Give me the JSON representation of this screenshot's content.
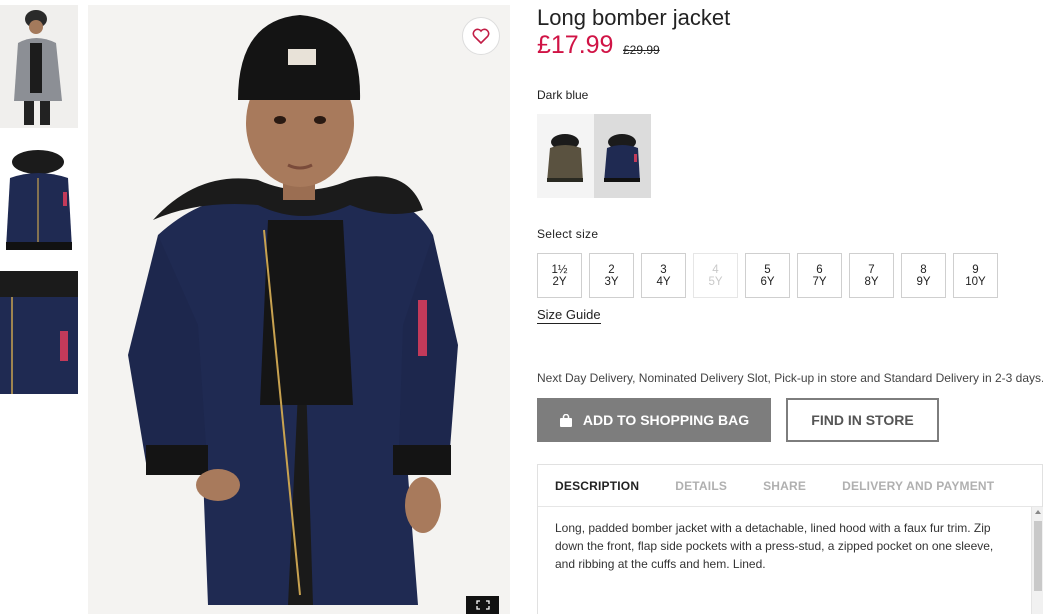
{
  "product": {
    "title": "Long bomber jacket",
    "price": "£17.99",
    "old_price": "£29.99",
    "color_name": "Dark blue"
  },
  "gallery": {
    "thumbnails": [
      "model-front-grey",
      "jacket-navy-flat",
      "jacket-navy-detail"
    ],
    "favourite_icon": "heart-icon",
    "expand_icon": "expand-icon"
  },
  "swatches": [
    {
      "name": "khaki-green",
      "color": "#5a5240",
      "selected": false
    },
    {
      "name": "dark-blue",
      "color": "#1f2a52",
      "selected": true
    }
  ],
  "size_section": {
    "label": "Select size",
    "sizes": [
      {
        "top": "1½",
        "bottom": "2Y",
        "available": true
      },
      {
        "top": "2",
        "bottom": "3Y",
        "available": true
      },
      {
        "top": "3",
        "bottom": "4Y",
        "available": true
      },
      {
        "top": "4",
        "bottom": "5Y",
        "available": false
      },
      {
        "top": "5",
        "bottom": "6Y",
        "available": true
      },
      {
        "top": "6",
        "bottom": "7Y",
        "available": true
      },
      {
        "top": "7",
        "bottom": "8Y",
        "available": true
      },
      {
        "top": "8",
        "bottom": "9Y",
        "available": true
      },
      {
        "top": "9",
        "bottom": "10Y",
        "available": true
      }
    ],
    "guide_label": "Size Guide"
  },
  "delivery": {
    "note": "Next Day Delivery, Nominated Delivery Slot, Pick-up in store and Standard Delivery in 2-3 days."
  },
  "actions": {
    "add_to_bag": "ADD TO SHOPPING BAG",
    "find_in_store": "FIND IN STORE"
  },
  "tabs": {
    "items": [
      "DESCRIPTION",
      "DETAILS",
      "SHARE",
      "DELIVERY AND PAYMENT"
    ],
    "active_index": 0,
    "description": "Long, padded bomber jacket with a detachable, lined hood with a faux fur trim. Zip down the front, flap side pockets with a press-stud, a zipped pocket on one sleeve, and ribbing at the cuffs and hem. Lined."
  },
  "colors": {
    "price_red": "#d01345",
    "button_grey": "#7d7d7d",
    "navy": "#1f2a52"
  }
}
